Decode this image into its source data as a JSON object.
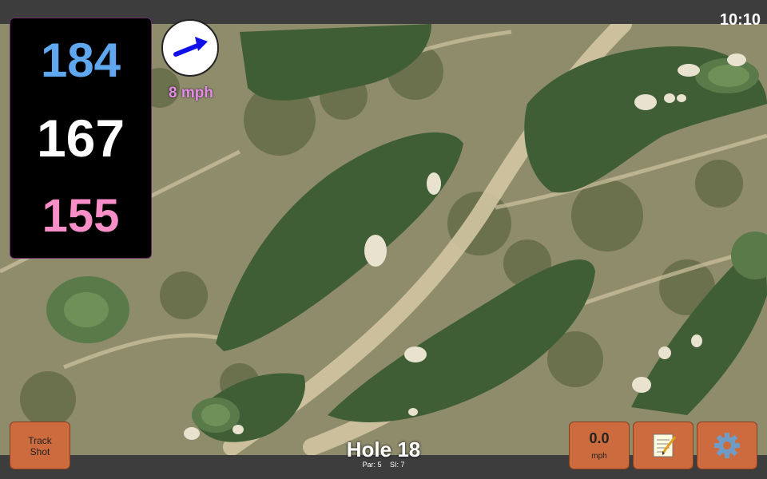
{
  "status": {
    "time": "10:10"
  },
  "distances": {
    "back": "184",
    "middle": "167",
    "front": "155"
  },
  "wind": {
    "speed_label": "8 mph",
    "icon": "wind-arrow-icon"
  },
  "buttons": {
    "track_shot_line1": "Track",
    "track_shot_line2": "Shot",
    "speed_value": "0.0",
    "speed_unit": "mph",
    "notes_icon": "notepad-icon",
    "settings_icon": "gear-icon"
  },
  "hole": {
    "title": "Hole 18",
    "par": "Par: 5",
    "si": "SI: 7"
  },
  "colors": {
    "back_distance": "#5fa8f0",
    "middle_distance": "#ffffff",
    "front_distance": "#f78ec8",
    "wind_label": "#e48ce8",
    "button": "#cc6b3d"
  }
}
